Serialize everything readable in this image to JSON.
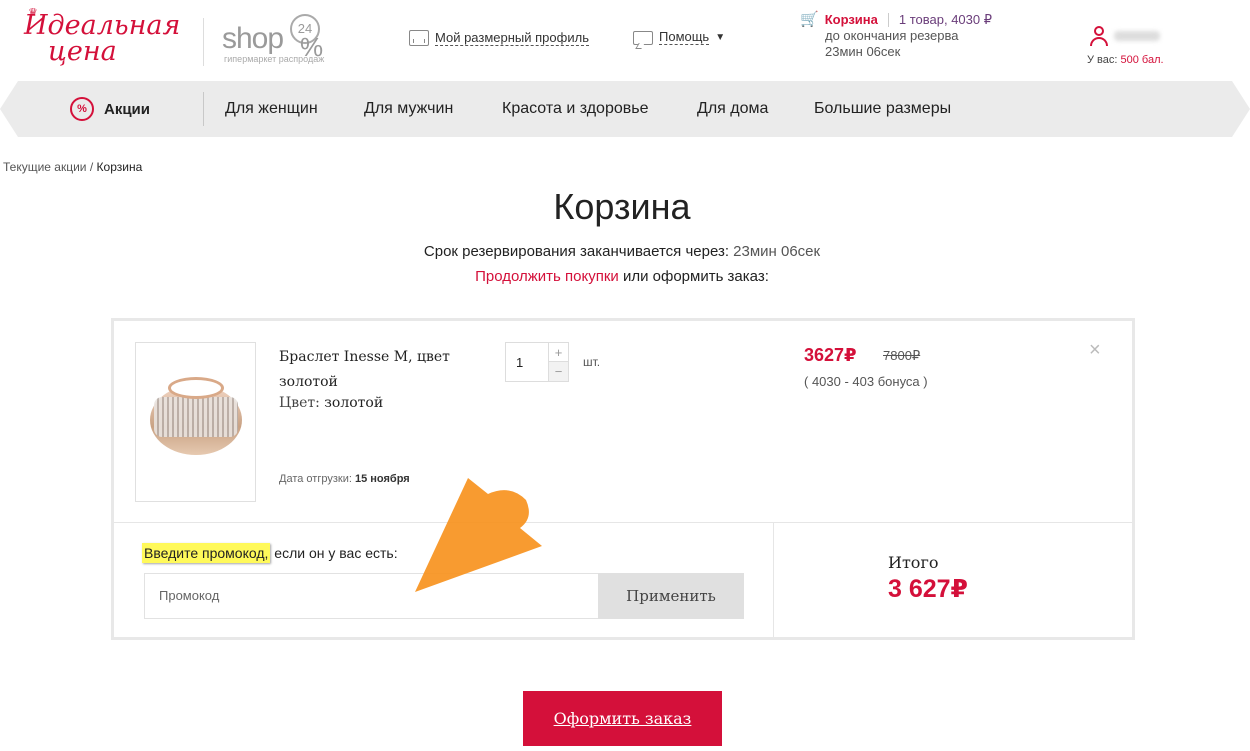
{
  "header": {
    "logo_line1": "Идеальная",
    "logo_line2": "цена",
    "shop_word": "shop",
    "shop_badge": "24",
    "shop_sub": "гипермаркет распродаж",
    "size_profile": "Мой размерный профиль",
    "help": "Помощь",
    "cart": {
      "title": "Корзина",
      "info": "1 товар, 4030 ₽",
      "reserve_line1": "до окончания резерва",
      "reserve_line2": "23мин 06сек"
    },
    "user": {
      "points_prefix": "У вас:",
      "points_link": "500 бал."
    }
  },
  "nav": {
    "promo": "Акции",
    "items": [
      "Для женщин",
      "Для мужчин",
      "Красота и здоровье",
      "Для дома",
      "Большие размеры"
    ]
  },
  "breadcrumb": {
    "item1": "Текущие акции",
    "sep": "/",
    "current": "Корзина"
  },
  "page": {
    "title": "Корзина",
    "reserve_text": "Срок резервирования заканчивается через:",
    "reserve_time": "23мин 06сек",
    "continue_link": "Продолжить покупки",
    "continue_rest": "или оформить заказ:"
  },
  "item": {
    "name": "Браслет Inesse M, цвет золотой",
    "color_label": "Цвет:",
    "color_value": "золотой",
    "ship_label": "Дата отгрузки:",
    "ship_date": "15 ноября",
    "qty": "1",
    "qty_unit": "шт.",
    "price": "3627₽",
    "old_price": "7800₽",
    "bonus": "( 4030 - 403 бонуса )",
    "remove": "×"
  },
  "promo": {
    "label_highlight": "Введите промокод,",
    "label_rest": " если он у вас есть:",
    "placeholder": "Промокод",
    "apply": "Применить"
  },
  "total": {
    "label": "Итого",
    "value": "3 627₽"
  },
  "checkout": "Оформить заказ",
  "colors": {
    "brand": "#d4103a",
    "highlight": "#fff95a",
    "arrow": "#f7931e"
  }
}
